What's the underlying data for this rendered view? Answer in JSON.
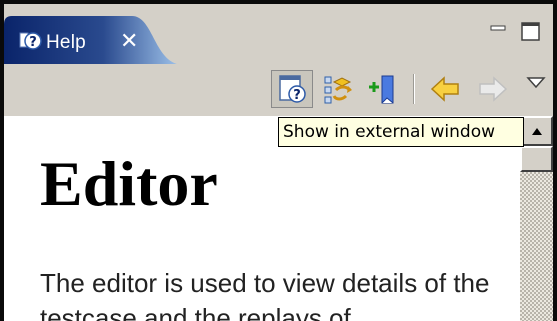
{
  "tab": {
    "label": "Help",
    "close_glyph": "✕",
    "icon": "help-icon"
  },
  "window_controls": {
    "minimize_icon": "minimize-icon",
    "maximize_icon": "maximize-icon"
  },
  "toolbar": {
    "buttons": [
      {
        "icon": "show-in-external-window-icon",
        "pressed": true
      },
      {
        "icon": "show-in-contents-icon",
        "pressed": false
      },
      {
        "icon": "bookmark-document-icon",
        "pressed": false
      },
      {
        "icon": "back-arrow-icon",
        "pressed": false
      },
      {
        "icon": "forward-arrow-icon",
        "enabled": false
      },
      {
        "icon": "view-menu-icon",
        "pressed": false
      }
    ]
  },
  "tooltip": {
    "text": "Show in external window"
  },
  "content": {
    "title": "Editor",
    "text": "The editor is used to view details of the testcase and the replays of"
  },
  "colors": {
    "tab_active": "#0a246a",
    "tab_gradient_end": "#a6caf0",
    "frame": "#d4d0c8",
    "tooltip_bg": "#ffffe1"
  }
}
